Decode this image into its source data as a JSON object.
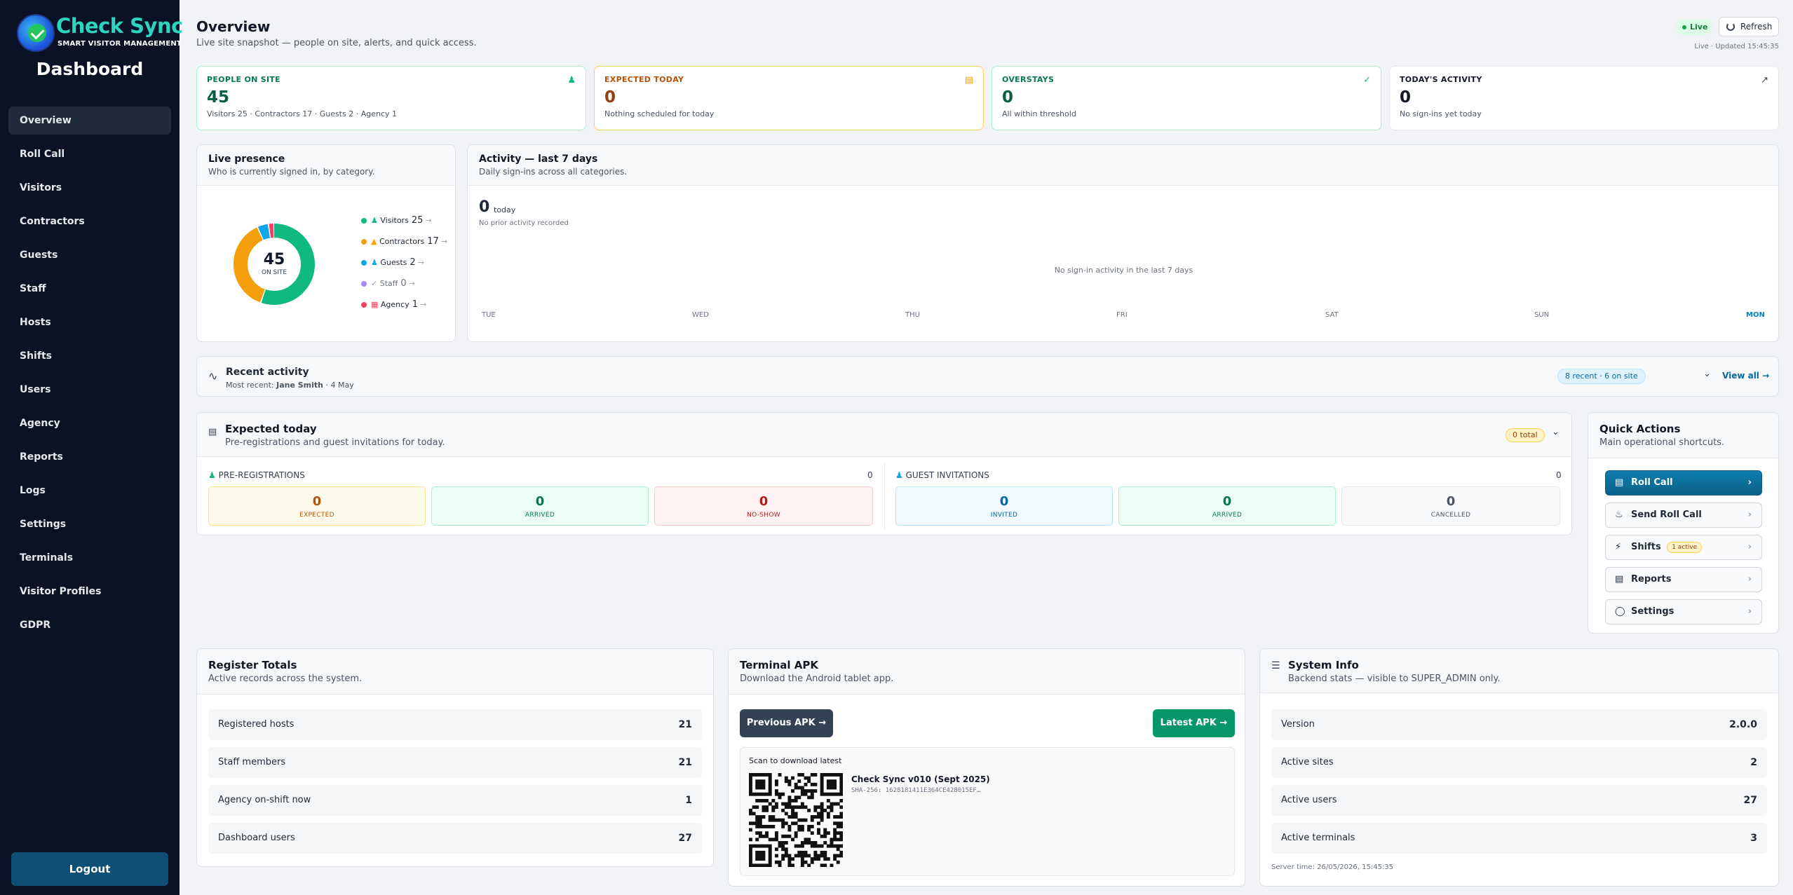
{
  "brand": {
    "name": "Check Sync",
    "tagline": "SMART VISITOR MANAGEMENT"
  },
  "sidebar": {
    "title": "Dashboard",
    "items": [
      "Overview",
      "Roll Call",
      "Visitors",
      "Contractors",
      "Guests",
      "Staff",
      "Hosts",
      "Shifts",
      "Users",
      "Agency",
      "Reports",
      "Logs",
      "Settings",
      "Terminals",
      "Visitor Profiles",
      "GDPR"
    ],
    "active": "Overview",
    "logout": "Logout"
  },
  "header": {
    "title": "Overview",
    "subtitle": "Live site snapshot — people on site, alerts, and quick access.",
    "live": "Live",
    "refresh": "Refresh",
    "updated": "Live · Updated 15:45:35"
  },
  "stats": [
    {
      "label": "PEOPLE ON SITE",
      "value": "45",
      "sub": "Visitors 25 · Contractors 17 · Guests 2 · Agency 1",
      "color": "#047857",
      "border": "#a7f3d0",
      "icon": "people-icon"
    },
    {
      "label": "EXPECTED TODAY",
      "value": "0",
      "sub": "Nothing scheduled for today",
      "color": "#b45309",
      "border": "#fcd34d",
      "icon": "calendar-icon"
    },
    {
      "label": "OVERSTAYS",
      "value": "0",
      "sub": "All within threshold",
      "color": "#047857",
      "border": "#a7f3d0",
      "icon": "shield-check-icon"
    },
    {
      "label": "TODAY'S ACTIVITY",
      "value": "0",
      "sub": "No sign-ins yet today",
      "color": "#111827",
      "border": "#e5e7eb",
      "icon": "trend-up-icon"
    }
  ],
  "presence": {
    "title": "Live presence",
    "subtitle": "Who is currently signed in, by category.",
    "total": "45",
    "total_label": "ON SITE",
    "legend": [
      {
        "name": "Visitors",
        "value": "25",
        "color": "#10b981"
      },
      {
        "name": "Contractors",
        "value": "17",
        "color": "#f59e0b"
      },
      {
        "name": "Guests",
        "value": "2",
        "color": "#0ea5e9"
      },
      {
        "name": "Staff",
        "value": "0",
        "color": "#a78bfa"
      },
      {
        "name": "Agency",
        "value": "1",
        "color": "#f43f5e"
      }
    ]
  },
  "activity": {
    "title": "Activity — last 7 days",
    "subtitle": "Daily sign-ins across all categories.",
    "today_value": "0",
    "today_label": "today",
    "prior": "No prior activity recorded",
    "empty": "No sign-in activity in the last 7 days",
    "days": [
      "TUE",
      "WED",
      "THU",
      "FRI",
      "SAT",
      "SUN",
      "MON"
    ]
  },
  "recent": {
    "title": "Recent activity",
    "most_recent_label": "Most recent:",
    "most_recent_name": "Jane Smith",
    "most_recent_date": "· 4 May",
    "badge": "8 recent · 6 on site",
    "view_all": "View all"
  },
  "expected": {
    "title": "Expected today",
    "subtitle": "Pre-registrations and guest invitations for today.",
    "badge": "0 total",
    "prereg": {
      "title": "PRE-REGISTRATIONS",
      "count": "0",
      "tiles": [
        {
          "n": "0",
          "l": "EXPECTED"
        },
        {
          "n": "0",
          "l": "ARRIVED"
        },
        {
          "n": "0",
          "l": "NO-SHOW"
        }
      ]
    },
    "guest": {
      "title": "GUEST INVITATIONS",
      "count": "0",
      "tiles": [
        {
          "n": "0",
          "l": "INVITED"
        },
        {
          "n": "0",
          "l": "ARRIVED"
        },
        {
          "n": "0",
          "l": "CANCELLED"
        }
      ]
    }
  },
  "quick": {
    "title": "Quick Actions",
    "subtitle": "Main operational shortcuts.",
    "items": [
      {
        "label": "Roll Call",
        "icon": "clipboard-icon"
      },
      {
        "label": "Send Roll Call",
        "icon": "bell-icon"
      },
      {
        "label": "Shifts",
        "icon": "lightning-icon",
        "badge": "1 active"
      },
      {
        "label": "Reports",
        "icon": "document-icon"
      },
      {
        "label": "Settings",
        "icon": "shield-icon"
      }
    ]
  },
  "register": {
    "title": "Register Totals",
    "subtitle": "Active records across the system.",
    "rows": [
      {
        "label": "Registered hosts",
        "value": "21"
      },
      {
        "label": "Staff members",
        "value": "21"
      },
      {
        "label": "Agency on-shift now",
        "value": "1"
      },
      {
        "label": "Dashboard users",
        "value": "27"
      }
    ]
  },
  "apk": {
    "title": "Terminal APK",
    "subtitle": "Download the Android tablet app.",
    "prev": "Previous APK",
    "latest": "Latest APK",
    "scan": "Scan to download latest",
    "version": "Check Sync v010 (Sept 2025)",
    "sha": "SHA-256: 1628181411E364CE428015EF…"
  },
  "sysinfo": {
    "title": "System Info",
    "subtitle": "Backend stats — visible to SUPER_ADMIN only.",
    "rows": [
      {
        "label": "Version",
        "value": "2.0.0"
      },
      {
        "label": "Active sites",
        "value": "2"
      },
      {
        "label": "Active users",
        "value": "27"
      },
      {
        "label": "Active terminals",
        "value": "3"
      }
    ],
    "server_time": "Server time: 26/05/2026, 15:45:35"
  }
}
